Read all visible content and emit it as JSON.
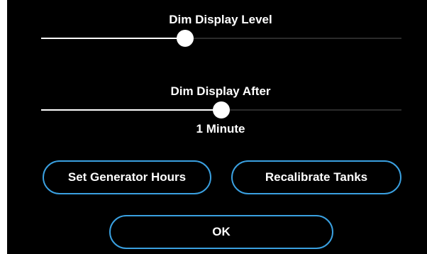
{
  "dim_level": {
    "label": "Dim Display Level",
    "value_fraction": 0.4
  },
  "dim_after": {
    "label": "Dim Display After",
    "value_fraction": 0.5,
    "value_text": "1 Minute"
  },
  "buttons": {
    "set_generator_hours": "Set Generator Hours",
    "recalibrate_tanks": "Recalibrate Tanks",
    "ok": "OK"
  },
  "colors": {
    "background": "#000000",
    "text": "#ffffff",
    "button_border": "#3aa0e0",
    "slider_fill": "#ffffff",
    "slider_track": "#2b2b2b"
  }
}
